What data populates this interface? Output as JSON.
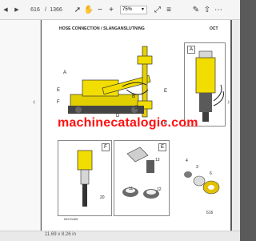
{
  "toolbar": {
    "page_current": "616",
    "page_separator": "/",
    "page_total": "1366",
    "zoom": "75%"
  },
  "document": {
    "title": "HOSE CONNECTION / SLANGANSLUTNING",
    "corner_text": "OCT",
    "watermark": "machinecatalogic.com",
    "small_code": "MD33488",
    "page_number": "616",
    "panel_labels": [
      "A",
      "F",
      "E"
    ],
    "callouts": [
      "A",
      "E",
      "B",
      "E",
      "F",
      "C",
      "D",
      "E",
      "20",
      "13",
      "11",
      "12",
      "4",
      "3",
      "6"
    ]
  },
  "status": {
    "size_text": "11.69 x 8.26 in"
  }
}
